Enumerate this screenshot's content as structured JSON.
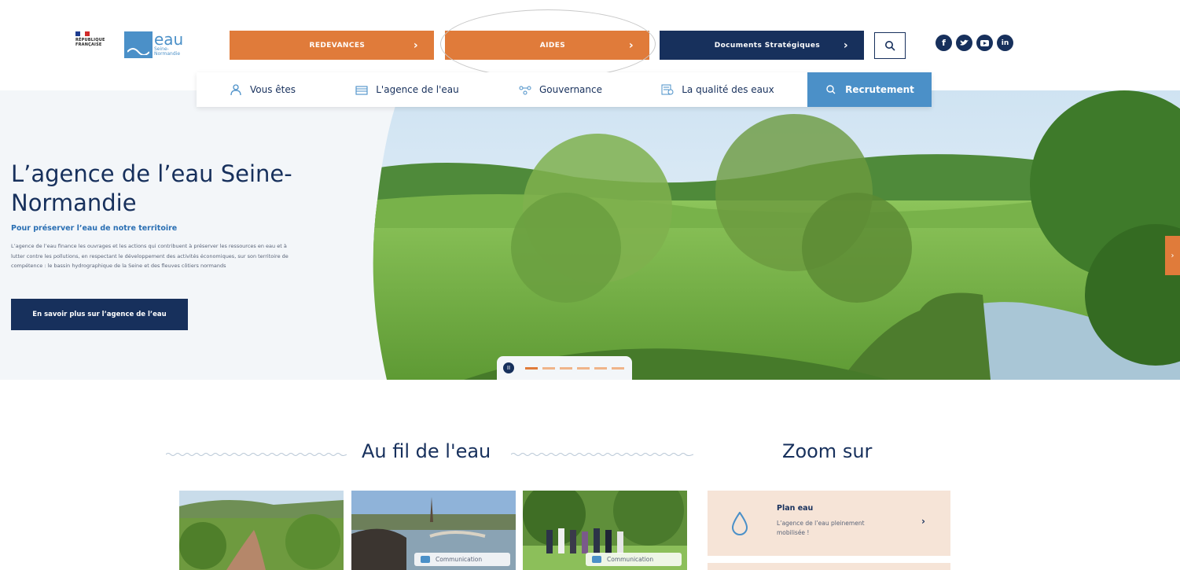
{
  "header": {
    "logo_rf_text": [
      "RÉPUBLIQUE",
      "FRANÇAISE"
    ],
    "logo_agency_word": "eau",
    "logo_agency_sub": "Seine-Normandie",
    "buttons": {
      "redevances": "REDEVANCES",
      "aides": "AIDES",
      "documents": "Documents Stratégiques"
    },
    "social": [
      "facebook-icon",
      "twitter-icon",
      "youtube-icon",
      "linkedin-icon"
    ]
  },
  "subnav": {
    "items": [
      "Vous êtes",
      "L'agence de l'eau",
      "Gouvernance",
      "La qualité des eaux"
    ],
    "recrutement": "Recrutement"
  },
  "hero": {
    "title": "L’agence de l’eau Seine-Normandie",
    "subtitle": "Pour préserver l’eau de notre territoire",
    "text": "L’agence de l’eau finance les ouvrages et les actions qui contribuent à préserver les ressources en eau et à lutter contre les pollutions, en respectant le développement des activités économiques, sur son territoire de compétence : le bassin hydrographique de la Seine et des fleuves côtiers normands",
    "cta": "En savoir plus sur l’agence de l’eau",
    "slides_count": 6,
    "active_slide": 1
  },
  "news": {
    "title": "Au fil de l'eau",
    "cards": [
      {
        "tag": ""
      },
      {
        "tag": "Communication"
      },
      {
        "tag": "Communication"
      }
    ]
  },
  "zoom": {
    "title": "Zoom sur",
    "card": {
      "title": "Plan eau",
      "desc": "L’agence de l’eau pleinement mobilisée !"
    }
  },
  "colors": {
    "orange": "#e07b3a",
    "navy": "#17305c",
    "blue": "#4b90c8",
    "peach": "#f6e4d7"
  }
}
